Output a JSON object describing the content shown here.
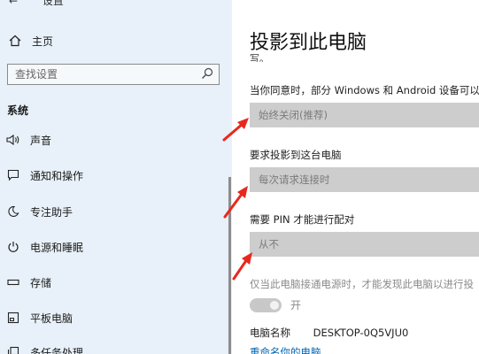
{
  "sidebar": {
    "top_cut_text": "设置",
    "home_label": "主页",
    "search_placeholder": "查找设置",
    "section_label": "系统",
    "items": [
      {
        "label": "声音"
      },
      {
        "label": "通知和操作"
      },
      {
        "label": "专注助手"
      },
      {
        "label": "电源和睡眠"
      },
      {
        "label": "存储"
      },
      {
        "label": "平板电脑"
      },
      {
        "label": "多任务处理"
      }
    ]
  },
  "main": {
    "title": "投影到此电脑",
    "subtitle_cut": "写。",
    "description": "当你同意时，部分 Windows 和 Android 设备可以投",
    "dropdown1": {
      "value": "始终关闭(推荐)"
    },
    "require_label": "要求投影到这台电脑",
    "dropdown2": {
      "value": "每次请求连接时"
    },
    "pin_label": "需要 PIN 才能进行配对",
    "dropdown3": {
      "value": "从不"
    },
    "power_note": "仅当此电脑接通电源时，才能发现此电脑以进行投",
    "toggle_label": "开",
    "pc_name_label": "电脑名称",
    "pc_name_value": "DESKTOP-0Q5VJU0",
    "rename_link": "重命名你的电脑"
  },
  "colors": {
    "sidebar_bg": "#e8f1f9",
    "dropdown_bg": "#cdcdcd",
    "link": "#0066b4",
    "annotation_arrow": "#e8281e"
  }
}
